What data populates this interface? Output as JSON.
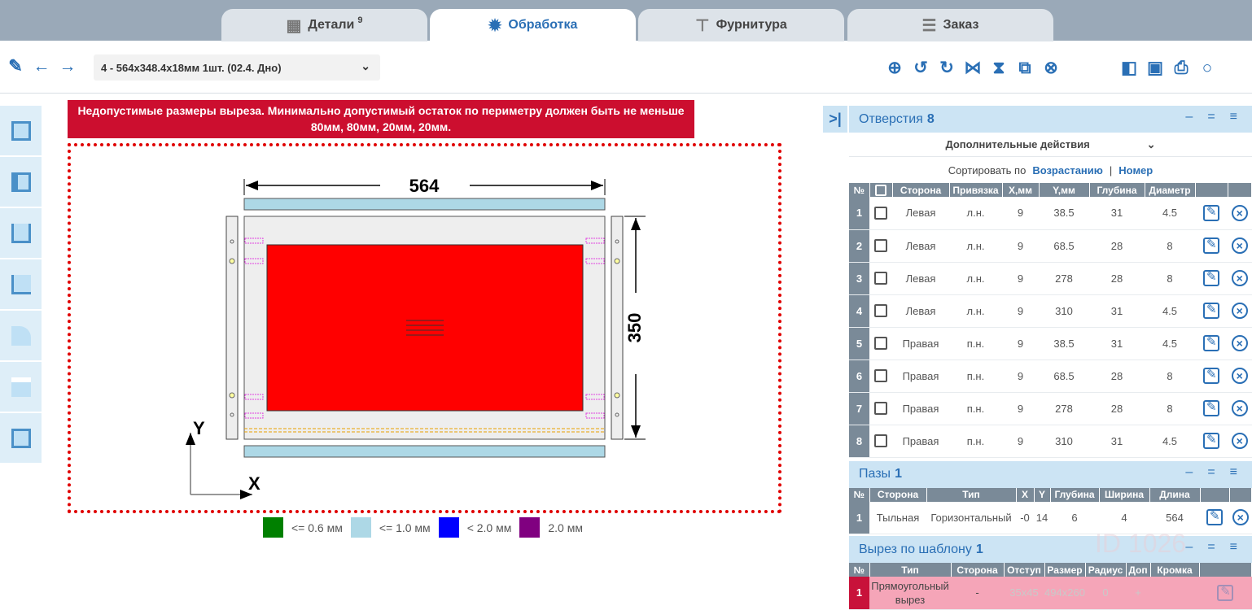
{
  "tabs": [
    {
      "label": "Детали",
      "badge": "9"
    },
    {
      "label": "Обработка"
    },
    {
      "label": "Фурнитура"
    },
    {
      "label": "Заказ"
    }
  ],
  "toolbar": {
    "selected_part": "4 - 564x348.4x18мм 1шт. (02.4. Дно)"
  },
  "error": {
    "line1": "Недопустимые размеры выреза. Минимально допустимый остаток по периметру должен быть не меньше",
    "line2": "80мм, 80мм, 20мм, 20мм."
  },
  "drawing": {
    "width_label": "564",
    "height_label": "350",
    "axis_x": "X",
    "axis_y": "Y"
  },
  "legend": [
    {
      "label": "<= 0.6 мм",
      "color": "#008000"
    },
    {
      "label": "<= 1.0 мм",
      "color": "#add8e6"
    },
    {
      "label": "< 2.0 мм",
      "color": "#0000ff"
    },
    {
      "label": "2.0 мм",
      "color": "#800080"
    }
  ],
  "holes": {
    "title": "Отверстия",
    "count": "8",
    "actions": "Дополнительные действия",
    "sort_label": "Сортировать по",
    "sort_order": "Возрастанию",
    "sort_sep": "|",
    "sort_field": "Номер",
    "columns": [
      "№",
      "",
      "Сторона",
      "Привязка",
      "X,мм",
      "Y,мм",
      "Глубина",
      "Диаметр"
    ],
    "rows": [
      [
        "1",
        "Левая",
        "л.н.",
        "9",
        "38.5",
        "31",
        "4.5"
      ],
      [
        "2",
        "Левая",
        "л.н.",
        "9",
        "68.5",
        "28",
        "8"
      ],
      [
        "3",
        "Левая",
        "л.н.",
        "9",
        "278",
        "28",
        "8"
      ],
      [
        "4",
        "Левая",
        "л.н.",
        "9",
        "310",
        "31",
        "4.5"
      ],
      [
        "5",
        "Правая",
        "п.н.",
        "9",
        "38.5",
        "31",
        "4.5"
      ],
      [
        "6",
        "Правая",
        "п.н.",
        "9",
        "68.5",
        "28",
        "8"
      ],
      [
        "7",
        "Правая",
        "п.н.",
        "9",
        "278",
        "28",
        "8"
      ],
      [
        "8",
        "Правая",
        "п.н.",
        "9",
        "310",
        "31",
        "4.5"
      ]
    ]
  },
  "grooves": {
    "title": "Пазы",
    "count": "1",
    "columns": [
      "№",
      "Сторона",
      "Тип",
      "X",
      "Y",
      "Глубина",
      "Ширина",
      "Длина"
    ],
    "rows": [
      [
        "1",
        "Тыльная",
        "Горизонтальный",
        "-0",
        "14",
        "6",
        "4",
        "564"
      ]
    ]
  },
  "cutout": {
    "title": "Вырез по шаблону",
    "count": "1",
    "columns": [
      "№",
      "Тип",
      "Сторона",
      "Отступ",
      "Размер",
      "Радиус",
      "Доп",
      "Кромка"
    ],
    "row": {
      "num": "1",
      "type": "Прямоугольный вырез",
      "side": "-",
      "offset": "35x45",
      "size": "494x260",
      "radius": "0",
      "extra": "+"
    }
  },
  "watermark": "ID 1026"
}
